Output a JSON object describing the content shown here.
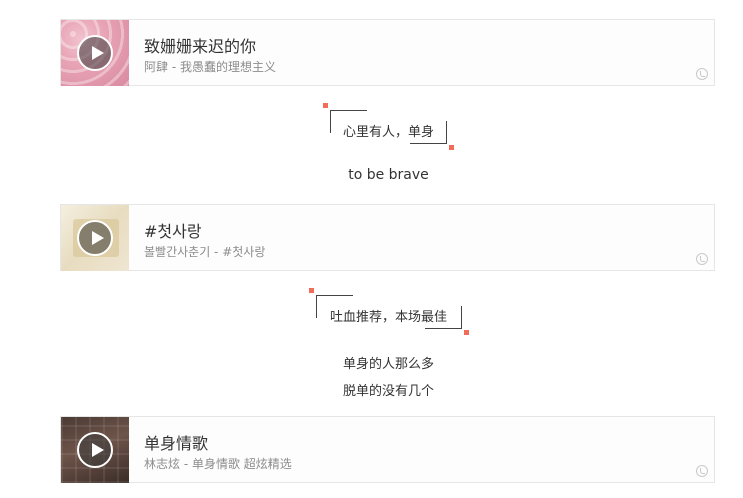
{
  "songs": [
    {
      "title": "致姗姗来迟的你",
      "subtitle": "阿肆 - 我愚蠢的理想主义"
    },
    {
      "title": "#첫사랑",
      "subtitle": "볼빨간사춘기 - #첫사랑"
    },
    {
      "title": "单身情歌",
      "subtitle": "林志炫 - 单身情歌 超炫精选"
    }
  ],
  "quotes": {
    "q1": "心里有人，单身",
    "q2": "to be brave",
    "q3": "吐血推荐，本场最佳",
    "q4_line1": "单身的人那么多",
    "q4_line2": "脱单的没有几个"
  },
  "colors": {
    "accent_dot": "#f26c5a",
    "card_border": "#e6e6e6"
  },
  "icons": {
    "play": "play-icon",
    "music_note": "music-note-icon"
  }
}
